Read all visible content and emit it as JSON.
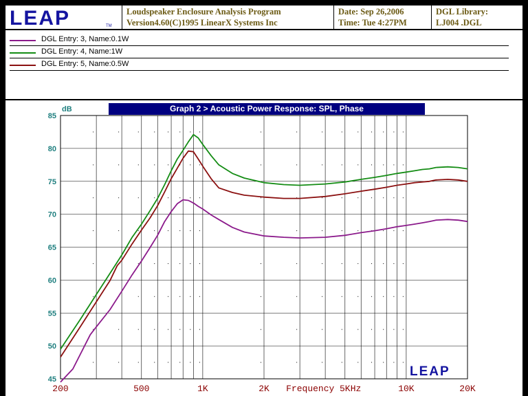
{
  "header": {
    "logo_text": "LEAP",
    "logo_tm": "TM",
    "program_line1": "Loudspeaker Enclosure Analysis Program",
    "program_line2": "Version4.60(C)1995 LinearX Systems Inc",
    "date_line": "Date: Sep 26,2006",
    "time_line": "Time: Tue  4:27PM",
    "library_line1": "DGL Library:",
    "library_line2": "LJ004   .DGL"
  },
  "legend": {
    "entries": [
      {
        "label": "DGL Entry: 3, Name:0.1W",
        "color": "#8b1a8b"
      },
      {
        "label": "DGL Entry: 4, Name:1W",
        "color": "#148c14"
      },
      {
        "label": "DGL Entry: 5, Name:0.5W",
        "color": "#8b1010"
      }
    ]
  },
  "chart_data": {
    "type": "line",
    "title": "Graph 2 > Acoustic Power Response: SPL, Phase",
    "ylabel": "dB",
    "xlabel": "Frequency   Hz",
    "xscale": "log",
    "xlim": [
      200,
      20000
    ],
    "ylim": [
      45,
      85
    ],
    "y_ticks": [
      45,
      50,
      55,
      60,
      65,
      70,
      75,
      80,
      85
    ],
    "x_tick_labels": [
      {
        "value": 200,
        "label": "200"
      },
      {
        "value": 500,
        "label": "500"
      },
      {
        "value": 1000,
        "label": "1K"
      },
      {
        "value": 2000,
        "label": "2K"
      },
      {
        "value": 5000,
        "label": "5K"
      },
      {
        "value": 10000,
        "label": "10K"
      },
      {
        "value": 20000,
        "label": "20K"
      }
    ],
    "grid": true,
    "watermark": "LEAP",
    "series": [
      {
        "name": "DGL Entry: 3, Name:0.1W",
        "color": "#8b1a8b",
        "x": [
          200,
          230,
          280,
          300,
          350,
          400,
          450,
          500,
          550,
          600,
          650,
          700,
          750,
          800,
          850,
          900,
          950,
          1000,
          1100,
          1200,
          1400,
          1600,
          2000,
          2500,
          3000,
          4000,
          5000,
          6000,
          7000,
          8000,
          9000,
          10000,
          11000,
          12000,
          13000,
          14000,
          16000,
          18000,
          20000
        ],
        "y": [
          44.5,
          46.5,
          51.7,
          52.9,
          55.5,
          58.3,
          60.8,
          62.9,
          64.9,
          66.8,
          68.9,
          70.4,
          71.6,
          72.2,
          72.1,
          71.7,
          71.2,
          70.8,
          69.9,
          69.2,
          68.0,
          67.3,
          66.7,
          66.5,
          66.4,
          66.5,
          66.8,
          67.2,
          67.5,
          67.8,
          68.1,
          68.3,
          68.5,
          68.7,
          68.9,
          69.1,
          69.2,
          69.1,
          68.9
        ]
      },
      {
        "name": "DGL Entry: 4, Name:1W",
        "color": "#148c14",
        "x": [
          200,
          250,
          300,
          350,
          400,
          450,
          500,
          550,
          600,
          650,
          700,
          750,
          800,
          850,
          900,
          950,
          1000,
          1100,
          1200,
          1400,
          1600,
          2000,
          2500,
          3000,
          4000,
          5000,
          6000,
          7000,
          8000,
          9000,
          10000,
          11000,
          12000,
          13000,
          14000,
          16000,
          18000,
          20000
        ],
        "y": [
          49.5,
          54.0,
          57.8,
          61.0,
          63.8,
          66.5,
          68.5,
          70.5,
          72.4,
          74.5,
          76.6,
          78.4,
          79.7,
          81.0,
          82.1,
          81.6,
          80.6,
          78.9,
          77.5,
          76.2,
          75.5,
          74.8,
          74.5,
          74.4,
          74.6,
          74.9,
          75.3,
          75.6,
          75.9,
          76.2,
          76.4,
          76.6,
          76.8,
          76.9,
          77.1,
          77.2,
          77.1,
          76.9
        ]
      },
      {
        "name": "DGL Entry: 5, Name:0.5W",
        "color": "#8b1010",
        "x": [
          200,
          250,
          300,
          350,
          380,
          400,
          450,
          500,
          550,
          600,
          650,
          700,
          750,
          800,
          850,
          900,
          950,
          1000,
          1100,
          1200,
          1400,
          1600,
          2000,
          2500,
          3000,
          4000,
          5000,
          6000,
          7000,
          8000,
          9000,
          10000,
          11000,
          12000,
          13000,
          14000,
          16000,
          18000,
          20000
        ],
        "y": [
          48.3,
          52.9,
          56.7,
          59.9,
          62.2,
          63.0,
          65.5,
          67.6,
          69.4,
          71.3,
          73.4,
          75.4,
          77.0,
          78.5,
          79.6,
          79.5,
          78.4,
          77.3,
          75.4,
          74.0,
          73.3,
          72.9,
          72.6,
          72.4,
          72.4,
          72.7,
          73.1,
          73.5,
          73.8,
          74.1,
          74.4,
          74.6,
          74.8,
          74.9,
          75.0,
          75.2,
          75.3,
          75.2,
          75.0
        ]
      }
    ]
  }
}
